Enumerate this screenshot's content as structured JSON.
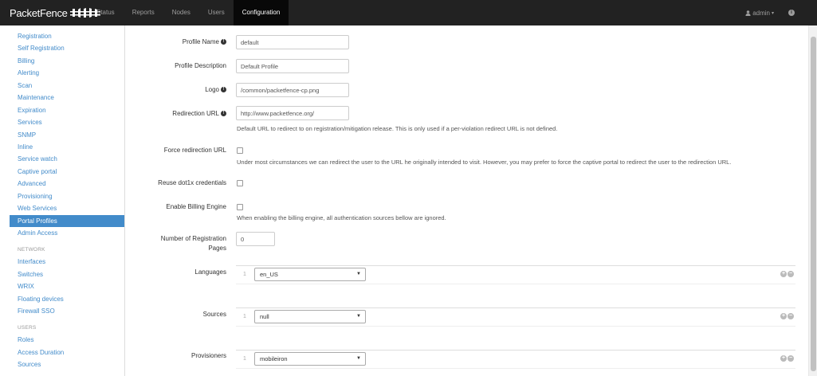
{
  "brand": {
    "name": "PacketFence"
  },
  "nav": {
    "items": [
      {
        "label": "Status"
      },
      {
        "label": "Reports"
      },
      {
        "label": "Nodes"
      },
      {
        "label": "Users"
      },
      {
        "label": "Configuration"
      }
    ],
    "user": "admin"
  },
  "sidebar": {
    "items": [
      {
        "label": "Registration"
      },
      {
        "label": "Self Registration"
      },
      {
        "label": "Billing"
      },
      {
        "label": "Alerting"
      },
      {
        "label": "Scan"
      },
      {
        "label": "Maintenance"
      },
      {
        "label": "Expiration"
      },
      {
        "label": "Services"
      },
      {
        "label": "SNMP"
      },
      {
        "label": "Inline"
      },
      {
        "label": "Service watch"
      },
      {
        "label": "Captive portal"
      },
      {
        "label": "Advanced"
      },
      {
        "label": "Provisioning"
      },
      {
        "label": "Web Services"
      },
      {
        "label": "Portal Profiles"
      },
      {
        "label": "Admin Access"
      }
    ],
    "network_header": "NETWORK",
    "network_items": [
      {
        "label": "Interfaces"
      },
      {
        "label": "Switches"
      },
      {
        "label": "WRIX"
      },
      {
        "label": "Floating devices"
      },
      {
        "label": "Firewall SSO"
      }
    ],
    "users_header": "USERS",
    "users_items": [
      {
        "label": "Roles"
      },
      {
        "label": "Access Duration"
      },
      {
        "label": "Sources"
      }
    ]
  },
  "form": {
    "profile_name": {
      "label": "Profile Name",
      "value": "default"
    },
    "profile_description": {
      "label": "Profile Description",
      "value": "Default Profile"
    },
    "logo": {
      "label": "Logo",
      "value": "/common/packetfence-cp.png"
    },
    "redirection_url": {
      "label": "Redirection URL",
      "value": "http://www.packetfence.org/",
      "help": "Default URL to redirect to on registration/mitigation release. This is only used if a per-violation redirect URL is not defined."
    },
    "force_redirection": {
      "label": "Force redirection URL",
      "help": "Under most circumstances we can redirect the user to the URL he originally intended to visit. However, you may prefer to force the captive portal to redirect the user to the redirection URL."
    },
    "reuse_dot1x": {
      "label": "Reuse dot1x credentials"
    },
    "enable_billing": {
      "label": "Enable Billing Engine",
      "help": "When enabling the billing engine, all authentication sources bellow are ignored."
    },
    "registration_pages": {
      "label_line1": "Number of Registration",
      "label_line2": "Pages",
      "value": "0"
    },
    "languages": {
      "label": "Languages",
      "index": "1",
      "value": "en_US"
    },
    "sources": {
      "label": "Sources",
      "index": "1",
      "value": "null"
    },
    "provisioners": {
      "label": "Provisioners",
      "index": "1",
      "value": "mobileiron"
    }
  }
}
